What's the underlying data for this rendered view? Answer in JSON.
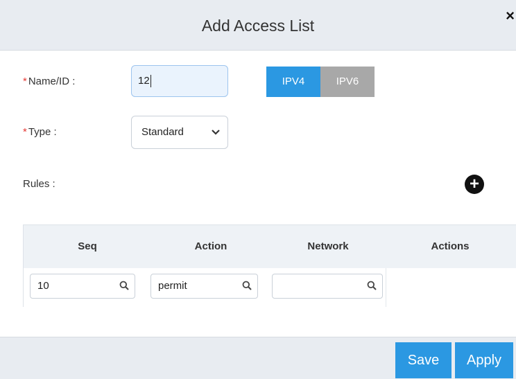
{
  "dialog": {
    "title": "Add Access List",
    "close_label": "×"
  },
  "form": {
    "name_label": "Name/ID :",
    "name_value": "12",
    "ip_versions": [
      "IPV4",
      "IPV6"
    ],
    "selected_ip_version": "IPV4",
    "type_label": "Type :",
    "type_value": "Standard",
    "required_marker": "*",
    "rules_label": "Rules :",
    "add_rule_label": "+"
  },
  "table": {
    "columns": [
      "Seq",
      "Action",
      "Network",
      "Actions"
    ],
    "rows": [
      {
        "seq": "10",
        "action": "permit",
        "network": ""
      }
    ]
  },
  "footer": {
    "save_label": "Save",
    "apply_label": "Apply"
  },
  "colors": {
    "accent": "#2b98e2",
    "inactive": "#a8a8a8",
    "header_bg": "#e8ecf1",
    "required": "#e53935"
  }
}
